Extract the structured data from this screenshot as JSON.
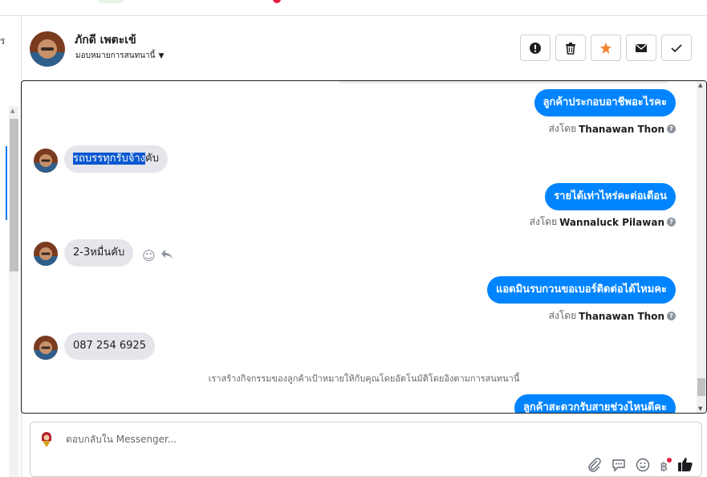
{
  "left_panel": {
    "fragment_text": "ร"
  },
  "header": {
    "contact_name": "ภักดี เพตะเข้",
    "assign_label": "มอบหมายการสนทนานี้",
    "actions": {
      "spam_icon": "exclamation-circle-icon",
      "delete_icon": "trash-icon",
      "star_icon": "star-icon",
      "unread_icon": "envelope-icon",
      "done_icon": "check-icon"
    }
  },
  "conversation": {
    "messages": [
      {
        "from": "page",
        "text": "ลูกค้าประกอบอาชีพอะไรคะ",
        "sent_by_label": "ส่งโดย",
        "agent": "Thanawan Thon"
      },
      {
        "from": "customer",
        "highlight": "รถบรรทุกรับจ้าง",
        "text": "คับ"
      },
      {
        "from": "page",
        "text": "รายได้เท่าไหร่คะต่อเดือน",
        "sent_by_label": "ส่งโดย",
        "agent": "Wannaluck Pilawan"
      },
      {
        "from": "customer",
        "text": "2-3หมื่นคับ"
      },
      {
        "from": "page",
        "text": "แอดมินรบกวนขอเบอร์ติดต่อได้ไหมคะ",
        "sent_by_label": "ส่งโดย",
        "agent": "Thanawan Thon"
      },
      {
        "from": "customer",
        "text": "087 254 6925"
      },
      {
        "from": "page",
        "text": "ลูกค้าสะดวกรับสายช่วงไหนดีคะ"
      }
    ],
    "system_note": "เราสร้างกิจกรรมของลูกค้าเป้าหมายให้กับคุณโดยอัตโนมัติโดยอิงตามการสนทนานี้"
  },
  "reply": {
    "placeholder": "ตอบกลับใน Messenger...",
    "value": ""
  },
  "colors": {
    "outgoing_bubble": "#0084ff",
    "incoming_bubble": "#e4e6eb",
    "star": "#f5802c",
    "highlight": "#0b57d0"
  }
}
